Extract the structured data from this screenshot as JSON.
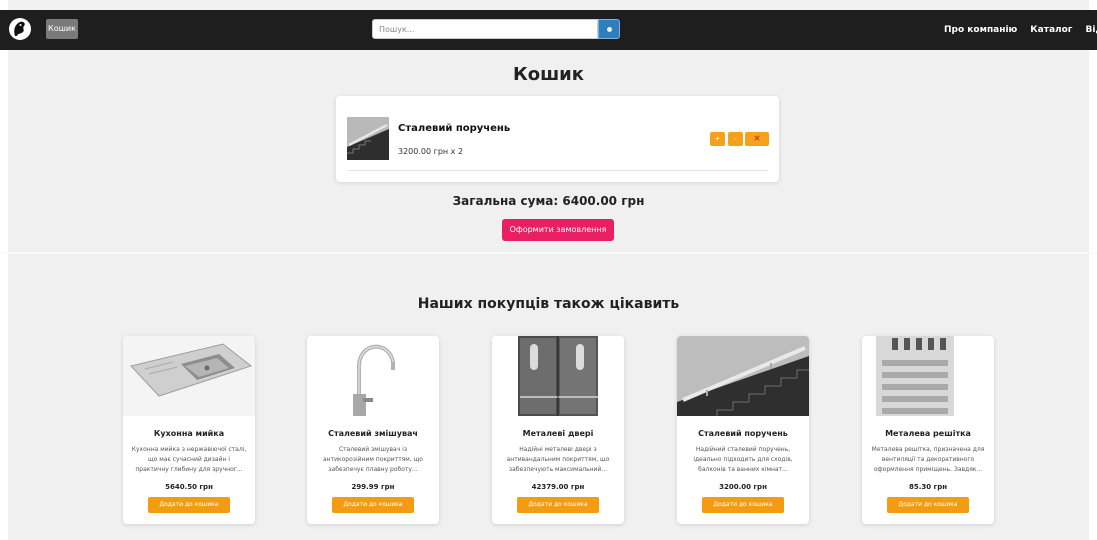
{
  "navbar": {
    "cart_label": "Кошик",
    "search": {
      "placeholder": "Пошук..."
    },
    "links": [
      "Про компанію",
      "Каталог",
      "Відгуки"
    ]
  },
  "cart": {
    "title": "Кошик",
    "item": {
      "name": "Сталевий поручень",
      "price_line": "3200.00 грн x 2"
    },
    "controls": {
      "plus": "+",
      "minus": "-",
      "remove": "✕"
    },
    "total": "Загальна сума: 6400.00 грн",
    "checkout_label": "Оформити замовлення"
  },
  "recommendations": {
    "title": "Наших покупців також цікавить",
    "button_label": "Додати до кошика",
    "products": [
      {
        "name": "Кухонна мийка",
        "description": "Кухонна мийка з нержавіючої сталі, що має сучасний дизайн і практичну глибину для зручног...",
        "price": "5640.50 грн"
      },
      {
        "name": "Сталевий змішувач",
        "description": "Сталевий змішувач із антикорозійним покриттям, що забезпечує плавну роботу...",
        "price": "299.99 грн"
      },
      {
        "name": "Металеві двері",
        "description": "Надійні металеві двері з антивандальним покриттям, що забезпечують максимальний...",
        "price": "42379.00 грн"
      },
      {
        "name": "Сталевий поручень",
        "description": "Надійний сталевий поручень, ідеально підходить для сходів, балконів та ванних кімнат...",
        "price": "3200.00 грн"
      },
      {
        "name": "Металева решітка",
        "description": "Металева решітка, призначена для вентиляції та декоративного оформлення приміщень. Завдяк...",
        "price": "85.30 грн"
      }
    ]
  }
}
